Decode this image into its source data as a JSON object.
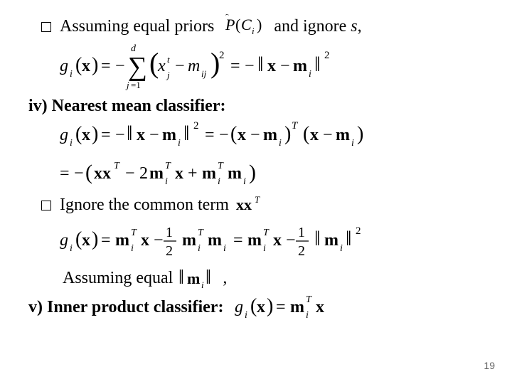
{
  "line1": {
    "prefix": "Assuming equal priors",
    "middle": "and ignore",
    "s": "s",
    "comma": ","
  },
  "headingIV": "iv) Nearest mean classifier:",
  "line2": "Ignore the common term",
  "line3": {
    "text": "Assuming equal",
    "comma": ","
  },
  "headingV": "v) Inner product classifier:",
  "pageNumber": "19",
  "formulas": {
    "PCi": {
      "P": "P",
      "C": "C",
      "i": "i"
    },
    "g1": {
      "g": "g",
      "i": "i",
      "x": "x",
      "j": "j",
      "d": "d",
      "t": "t",
      "m": "m",
      "eq": "=",
      "minus": "−",
      "sum": "∑",
      "sq": "2",
      "norm": "‖",
      "one": "1"
    },
    "xxT": {
      "x": "x",
      "T": "T"
    },
    "normMi": {
      "norm": "‖",
      "m": "m",
      "i": "i"
    },
    "giFinal": {
      "g": "g",
      "i": "i",
      "x": "x",
      "eq": "=",
      "m": "m",
      "T": "T"
    }
  }
}
